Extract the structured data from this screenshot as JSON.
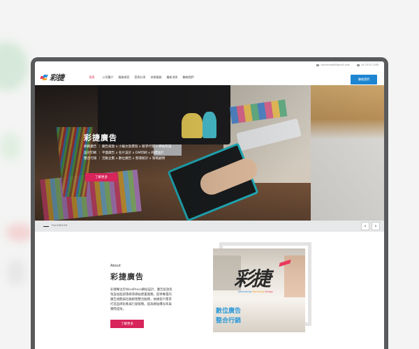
{
  "colors": {
    "accent": "#d7245a",
    "brand_blue": "#1e86d1",
    "frame": "#595a5c"
  },
  "topbar": {
    "email": "caizhenadd@gmail.com",
    "phone": "04-3333-1188",
    "email_icon": "envelope-icon",
    "phone_icon": "phone-icon"
  },
  "header": {
    "logo_text": "彩捷",
    "nav": [
      {
        "label": "首頁",
        "active": true
      },
      {
        "label": "公司簡介"
      },
      {
        "label": "服務項目"
      },
      {
        "label": "案例分享"
      },
      {
        "label": "技術服務"
      },
      {
        "label": "最新消息"
      },
      {
        "label": "聯絡我們"
      }
    ],
    "cta_label": "聯絡我們"
  },
  "hero": {
    "title": "彩捷廣告",
    "lines": [
      "網路廣告 ｜ 廣告投放 x 小編文案撰寫 x 競爭代管 x 網站架設",
      "設計印刷 ｜ 平面廣告 x 名片設計 x DM印刷 x 商標設計",
      "整合行銷 ｜ 活動企劃 x 數位廣告 x 營運統計 x 策略顧問"
    ],
    "button_label": "了解更多"
  },
  "slider": {
    "label": "FACEBOOK",
    "prev": "‹",
    "next": "›"
  },
  "about": {
    "kicker": "About",
    "title": "彩捷廣告",
    "text": "彩捷專注於WordPress網站設計、廣告投放及架設站點部落格等網站建置服務。提供專業的廣告規劃與社群經營整合服務，依據客戶需求打造品牌形象與行銷策略，提高網站曝光率與實際成效。",
    "button_label": "了解更多",
    "image": {
      "logo": "彩捷",
      "tagline": [
        "Advertising",
        "Marketing",
        "Design"
      ],
      "line1": "數位廣告",
      "line2": "整合行銷"
    }
  }
}
